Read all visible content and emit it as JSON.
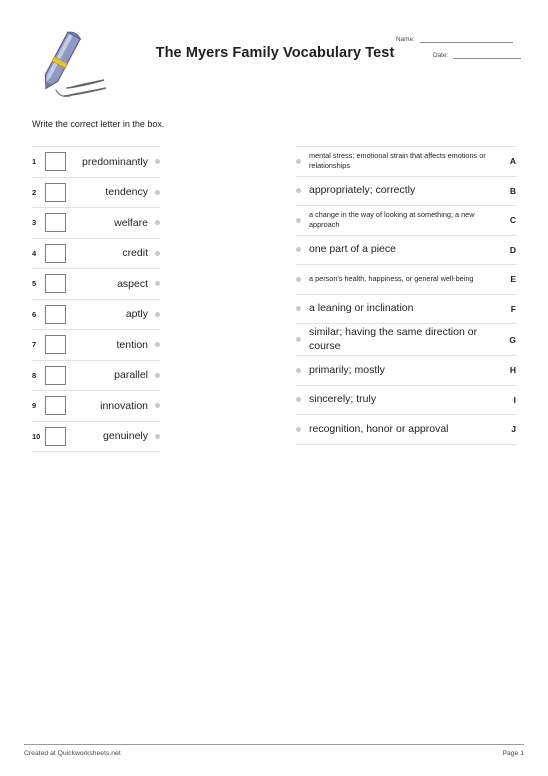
{
  "header": {
    "title": "The Myers Family Vocabulary Test",
    "logo_icon": "fountain-pen-writing-icon",
    "name_label": "Name:",
    "date_label": "Date:"
  },
  "instructions": "Write the correct letter in the box.",
  "questions": [
    {
      "num": "1",
      "word": "predominantly"
    },
    {
      "num": "2",
      "word": "tendency"
    },
    {
      "num": "3",
      "word": "welfare"
    },
    {
      "num": "4",
      "word": "credit"
    },
    {
      "num": "5",
      "word": "aspect"
    },
    {
      "num": "6",
      "word": "aptly"
    },
    {
      "num": "7",
      "word": "tention"
    },
    {
      "num": "8",
      "word": "parallel"
    },
    {
      "num": "9",
      "word": "innovation"
    },
    {
      "num": "10",
      "word": "genuinely"
    }
  ],
  "answers": [
    {
      "letter": "A",
      "text": "mental stress; emotional strain that affects emotions or relationships",
      "size": "small"
    },
    {
      "letter": "B",
      "text": "appropriately; correctly",
      "size": "normal"
    },
    {
      "letter": "C",
      "text": "a change in the way of looking at something; a new approach",
      "size": "small"
    },
    {
      "letter": "D",
      "text": "one part of a piece",
      "size": "normal"
    },
    {
      "letter": "E",
      "text": "a person's health, happiness, or general well-being",
      "size": "small"
    },
    {
      "letter": "F",
      "text": "a leaning or inclination",
      "size": "normal"
    },
    {
      "letter": "G",
      "text": "similar; having the same direction or course",
      "size": "normal"
    },
    {
      "letter": "H",
      "text": "primarily; mostly",
      "size": "normal"
    },
    {
      "letter": "I",
      "text": "sincerely; truly",
      "size": "normal"
    },
    {
      "letter": "J",
      "text": "recognition, honor or approval",
      "size": "normal"
    }
  ],
  "footer": {
    "credit": "Created at Quickworksheets.net",
    "page": "Page 1"
  },
  "colors": {
    "text": "#231f20",
    "rule": "#e2e2e2",
    "bullet": "#c9c9c9",
    "box_border": "#7d7d7d",
    "pen_body": "#9099c4",
    "pen_highlight": "#c4cbe4",
    "pen_band": "#e8c33a"
  }
}
